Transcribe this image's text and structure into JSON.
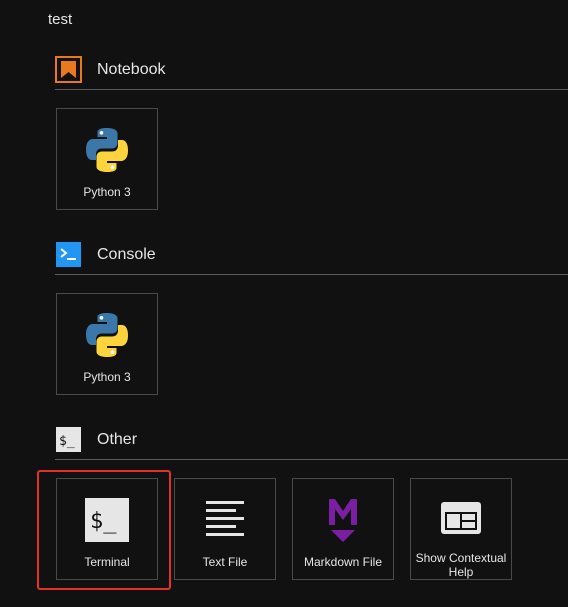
{
  "path": "test",
  "sections": {
    "notebook": {
      "title": "Notebook",
      "icon": "notebook-icon",
      "accent": "#e87a1d",
      "items": [
        {
          "label": "Python 3",
          "icon": "python-icon"
        }
      ]
    },
    "console": {
      "title": "Console",
      "icon": "console-icon",
      "accent": "#2196f3",
      "items": [
        {
          "label": "Python 3",
          "icon": "python-icon"
        }
      ]
    },
    "other": {
      "title": "Other",
      "icon": "terminal-icon",
      "items": [
        {
          "label": "Terminal",
          "icon": "terminal-icon"
        },
        {
          "label": "Text File",
          "icon": "text-file-icon"
        },
        {
          "label": "Markdown File",
          "icon": "markdown-icon",
          "accent": "#7b1fa2"
        },
        {
          "label": "Show Contextual Help",
          "icon": "contextual-help-icon"
        }
      ]
    }
  },
  "highlight_color": "#e3302a"
}
